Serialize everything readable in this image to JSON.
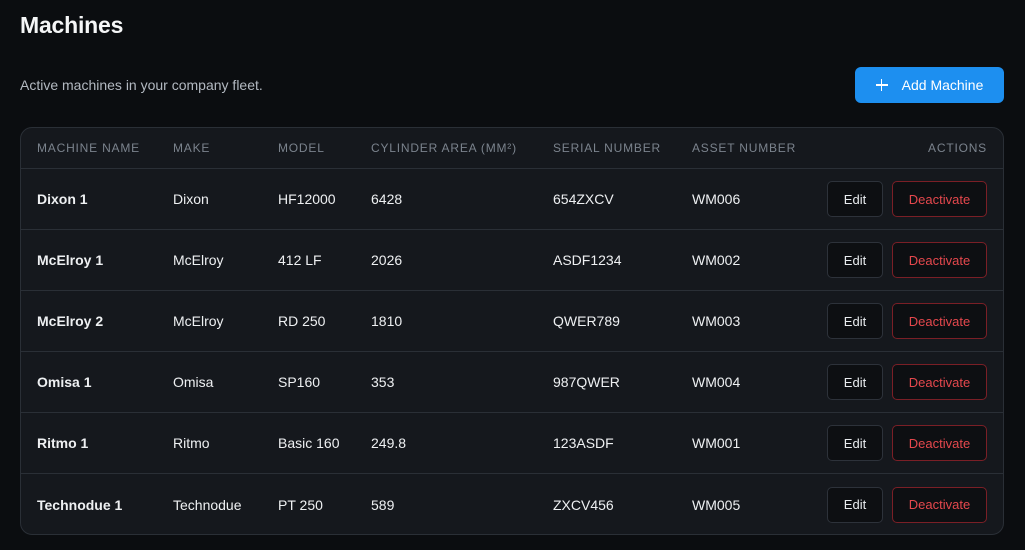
{
  "header": {
    "title": "Machines",
    "subtitle": "Active machines in your company fleet.",
    "add_button_label": "Add Machine"
  },
  "table": {
    "columns": [
      "MACHINE NAME",
      "MAKE",
      "MODEL",
      "CYLINDER AREA (MM²)",
      "SERIAL NUMBER",
      "ASSET NUMBER",
      "ACTIONS"
    ],
    "edit_label": "Edit",
    "deactivate_label": "Deactivate",
    "rows": [
      {
        "name": "Dixon 1",
        "make": "Dixon",
        "model": "HF12000",
        "cylinder_area": "6428",
        "serial": "654ZXCV",
        "asset": "WM006"
      },
      {
        "name": "McElroy 1",
        "make": "McElroy",
        "model": "412 LF",
        "cylinder_area": "2026",
        "serial": "ASDF1234",
        "asset": "WM002"
      },
      {
        "name": "McElroy 2",
        "make": "McElroy",
        "model": "RD 250",
        "cylinder_area": "1810",
        "serial": "QWER789",
        "asset": "WM003"
      },
      {
        "name": "Omisa 1",
        "make": "Omisa",
        "model": "SP160",
        "cylinder_area": "353",
        "serial": "987QWER",
        "asset": "WM004"
      },
      {
        "name": "Ritmo 1",
        "make": "Ritmo",
        "model": "Basic 160",
        "cylinder_area": "249.8",
        "serial": "123ASDF",
        "asset": "WM001"
      },
      {
        "name": "Technodue 1",
        "make": "Technodue",
        "model": "PT 250",
        "cylinder_area": "589",
        "serial": "ZXCV456",
        "asset": "WM005"
      }
    ]
  },
  "colors": {
    "accent": "#1d8ff0",
    "danger": "#e5484d",
    "background": "#0b0d10",
    "surface": "#15181d"
  }
}
